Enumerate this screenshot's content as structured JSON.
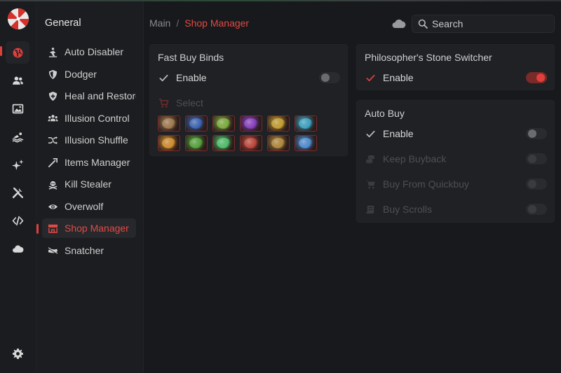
{
  "theme": {
    "accent": "#e0403c",
    "background": "#18191c",
    "panel": "#202125"
  },
  "rail": {
    "items": [
      {
        "name": "globe-icon",
        "active": true
      },
      {
        "name": "users-icon"
      },
      {
        "name": "image-icon"
      },
      {
        "name": "swim-icon"
      },
      {
        "name": "sparkle-icon"
      },
      {
        "name": "tools-icon"
      },
      {
        "name": "code-icon"
      },
      {
        "name": "cloud-icon"
      }
    ],
    "settings_icon": "gear-icon"
  },
  "nav": {
    "title": "General",
    "items": [
      {
        "label": "Auto Disabler",
        "icon": "auto-disabler-icon"
      },
      {
        "label": "Dodger",
        "icon": "shield-icon"
      },
      {
        "label": "Heal and Restore",
        "icon": "shield-plus-icon"
      },
      {
        "label": "Illusion Control",
        "icon": "users-icon"
      },
      {
        "label": "Illusion Shuffle",
        "icon": "shuffle-icon"
      },
      {
        "label": "Items Manager",
        "icon": "wand-icon"
      },
      {
        "label": "Kill Stealer",
        "icon": "skull-icon"
      },
      {
        "label": "Overwolf",
        "icon": "eye-icon"
      },
      {
        "label": "Shop Manager",
        "icon": "shop-icon",
        "active": true
      },
      {
        "label": "Snatcher",
        "icon": "hand-icon"
      }
    ]
  },
  "header": {
    "breadcrumb_root": "Main",
    "breadcrumb_sep": "/",
    "breadcrumb_current": "Shop Manager",
    "search_placeholder": "Search"
  },
  "fast_buy": {
    "title": "Fast Buy Binds",
    "enable_label": "Enable",
    "enable_on": false,
    "select_label": "Select",
    "items": [
      {
        "name": "scroll-item",
        "color": "#a27b4e"
      },
      {
        "name": "blue-potion-item",
        "color": "#3a67b8"
      },
      {
        "name": "green-leaf-item",
        "color": "#7fb13d"
      },
      {
        "name": "purple-orb-item",
        "color": "#8a3fc4"
      },
      {
        "name": "gold-beetle-item",
        "color": "#c8a12e"
      },
      {
        "name": "blue-gem-item",
        "color": "#3aa7c7"
      },
      {
        "name": "orange-claw-item",
        "color": "#d7902c"
      },
      {
        "name": "green-apple-item",
        "color": "#55a83a"
      },
      {
        "name": "green-wing-item",
        "color": "#4fc46a"
      },
      {
        "name": "red-orb-item",
        "color": "#c2473a"
      },
      {
        "name": "gold-horn-item",
        "color": "#b58a3a"
      },
      {
        "name": "blue-crystal-item",
        "color": "#4d8fd6"
      }
    ]
  },
  "philosopher": {
    "title": "Philosopher's Stone Switcher",
    "enable_label": "Enable",
    "enable_on": true
  },
  "auto_buy": {
    "title": "Auto Buy",
    "rows": [
      {
        "label": "Enable",
        "icon": "check-icon",
        "disabled": false
      },
      {
        "label": "Keep Buyback",
        "icon": "coins-icon",
        "disabled": true
      },
      {
        "label": "Buy From Quickbuy",
        "icon": "cart-icon",
        "disabled": true
      },
      {
        "label": "Buy Scrolls",
        "icon": "scroll-icon",
        "disabled": true
      }
    ]
  }
}
